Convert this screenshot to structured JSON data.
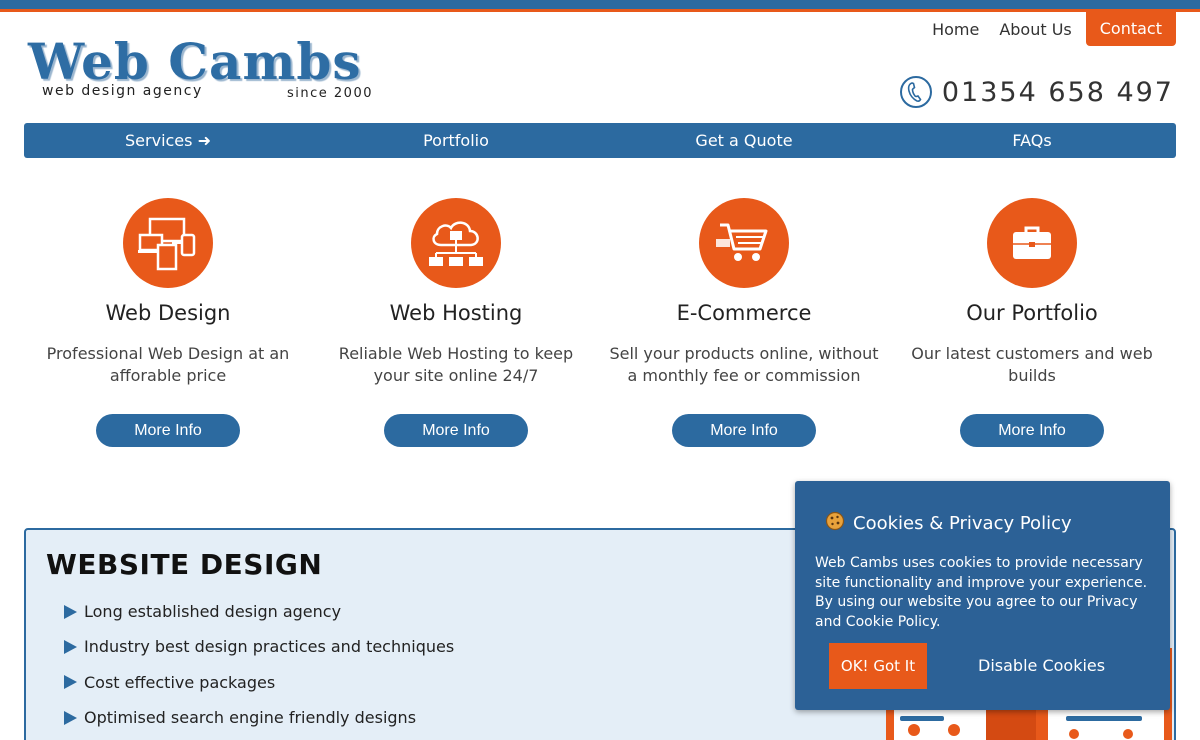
{
  "logo": {
    "name": "Web Cambs",
    "tagline": "web design agency",
    "since": "since 2000"
  },
  "topnav": {
    "home": "Home",
    "about": "About Us",
    "contact": "Contact"
  },
  "phone": {
    "number": "01354 658 497",
    "icon": "phone-icon"
  },
  "mainnav": {
    "items": [
      "Services ➜",
      "Portfolio",
      "Get a Quote",
      "FAQs"
    ]
  },
  "features": [
    {
      "title": "Web Design",
      "text": "Professional Web Design at an afforable price",
      "button": "More Info",
      "icon": "devices-icon"
    },
    {
      "title": "Web Hosting",
      "text": "Reliable Web Hosting to keep your site online 24/7",
      "button": "More Info",
      "icon": "cloud-network-icon"
    },
    {
      "title": "E-Commerce",
      "text": "Sell your products online, without a monthly fee or commission",
      "button": "More Info",
      "icon": "shopping-cart-icon"
    },
    {
      "title": "Our Portfolio",
      "text": "Our latest customers and web builds",
      "button": "More Info",
      "icon": "briefcase-icon"
    }
  ],
  "website_design": {
    "title": "WEBSITE DESIGN",
    "items": [
      "Long established design agency",
      "Industry best design practices and techniques",
      "Cost effective packages",
      "Optimised search engine friendly designs"
    ]
  },
  "cookie": {
    "title": "Cookies & Privacy Policy",
    "text": "Web Cambs uses cookies to provide necessary site functionality and improve your experience. By using our website you agree to our Privacy and Cookie Policy.",
    "ok": "OK! Got It",
    "disable": "Disable Cookies"
  },
  "colors": {
    "brand_blue": "#2c6aa0",
    "accent_orange": "#e8591a",
    "panel_bg": "#e4eef7",
    "cookie_bg": "#2c6196"
  }
}
